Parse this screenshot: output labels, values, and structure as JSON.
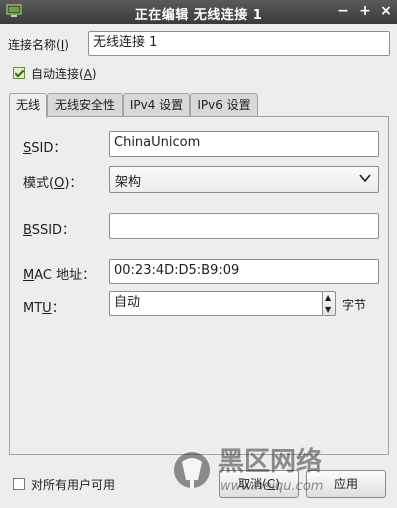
{
  "window": {
    "title": "正在编辑 无线连接 1",
    "minimize": "−",
    "maximize": "+",
    "close": "×"
  },
  "connection_name": {
    "label_prefix": "连接名称(",
    "mnemonic": "I",
    "label_suffix": ")",
    "value": "无线连接 1"
  },
  "auto_connect": {
    "label_prefix": "自动连接(",
    "mnemonic": "A",
    "label_suffix": ")",
    "checked": true
  },
  "tabs": [
    {
      "label": "无线",
      "active": true
    },
    {
      "label": "无线安全性",
      "active": false
    },
    {
      "label": "IPv4 设置",
      "active": false
    },
    {
      "label": "IPv6 设置",
      "active": false
    }
  ],
  "wireless": {
    "ssid": {
      "mnemonic": "S",
      "label_rest": "SID：",
      "value": "ChinaUnicom"
    },
    "mode": {
      "label_prefix": "模式(",
      "mnemonic": "O",
      "label_suffix": ")：",
      "value": "架构"
    },
    "bssid": {
      "mnemonic": "B",
      "label_rest": "SSID：",
      "value": ""
    },
    "mac": {
      "mnemonic": "M",
      "label_rest": "AC 地址：",
      "value": "00:23:4D:D5:B9:09"
    },
    "mtu": {
      "label_prefix": "MT",
      "mnemonic": "U",
      "label_suffix": "：",
      "value": "自动",
      "unit": "字节"
    }
  },
  "footer": {
    "all_users_label": "对所有用户可用",
    "all_users_checked": false,
    "cancel": {
      "prefix": "取消(",
      "mnemonic": "C",
      "suffix": ")"
    },
    "apply": "应用"
  },
  "watermark": {
    "title": "黑区网络",
    "url": "www.heiqu.com"
  }
}
